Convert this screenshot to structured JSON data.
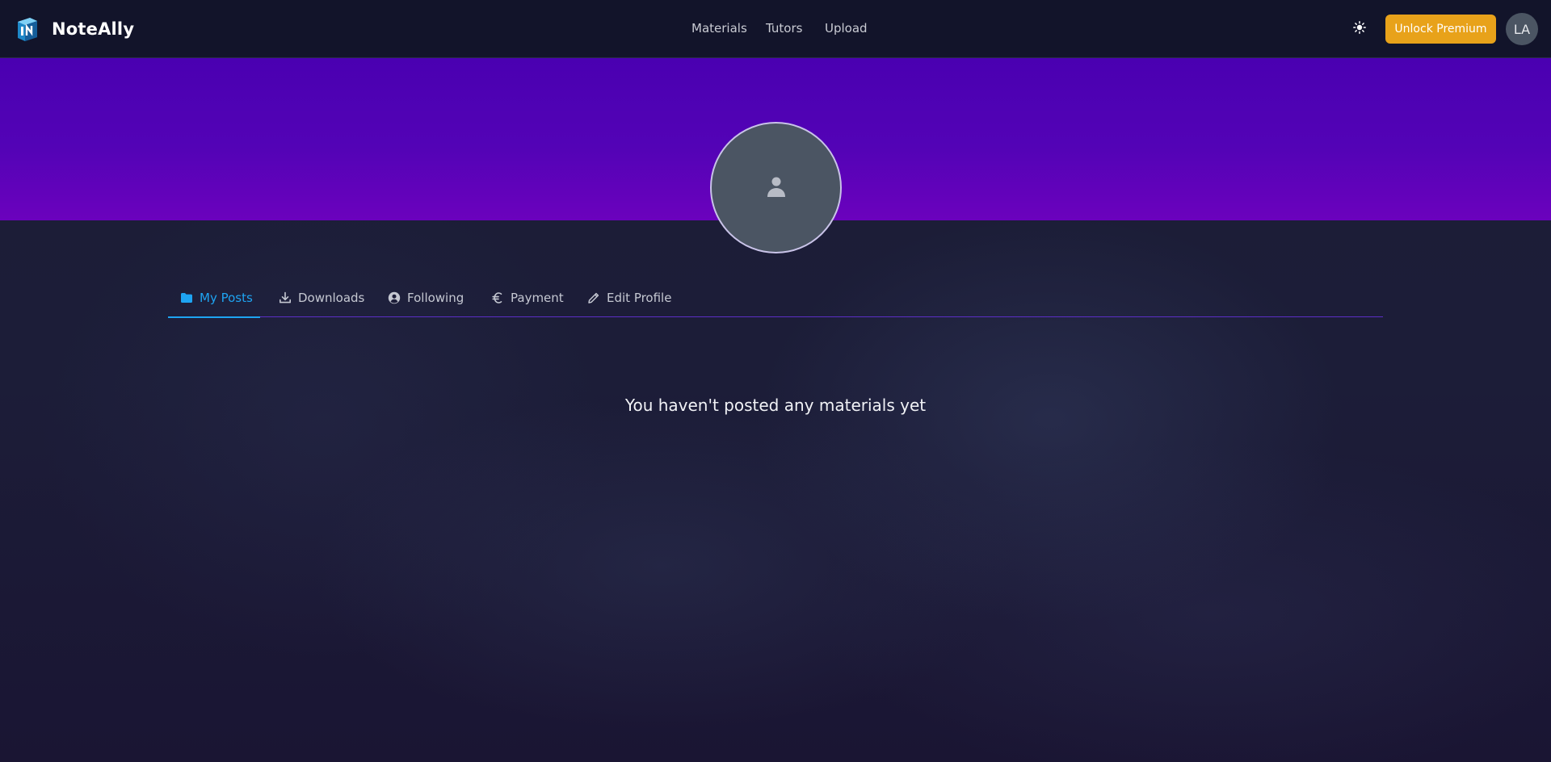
{
  "header": {
    "brand": "NoteAlly",
    "nav": [
      "Materials",
      "Tutors",
      "Upload"
    ],
    "premium_label": "Unlock Premium",
    "user_initials": "LA",
    "theme_icon": "sun-icon"
  },
  "profile": {
    "photo_icon": "user-silhouette-icon"
  },
  "tabs": [
    {
      "label": "My Posts",
      "icon": "folder-icon",
      "active": true
    },
    {
      "label": "Downloads",
      "icon": "download-icon",
      "active": false
    },
    {
      "label": "Following",
      "icon": "user-circle-icon",
      "active": false
    },
    {
      "label": "Payment",
      "icon": "euro-icon",
      "active": false
    },
    {
      "label": "Edit Profile",
      "icon": "pencil-icon",
      "active": false
    }
  ],
  "content": {
    "empty_message": "You haven't posted any materials yet"
  },
  "colors": {
    "accent": "#1ea4f2",
    "premium": "#e8a21a",
    "banner": "#5303b6"
  }
}
